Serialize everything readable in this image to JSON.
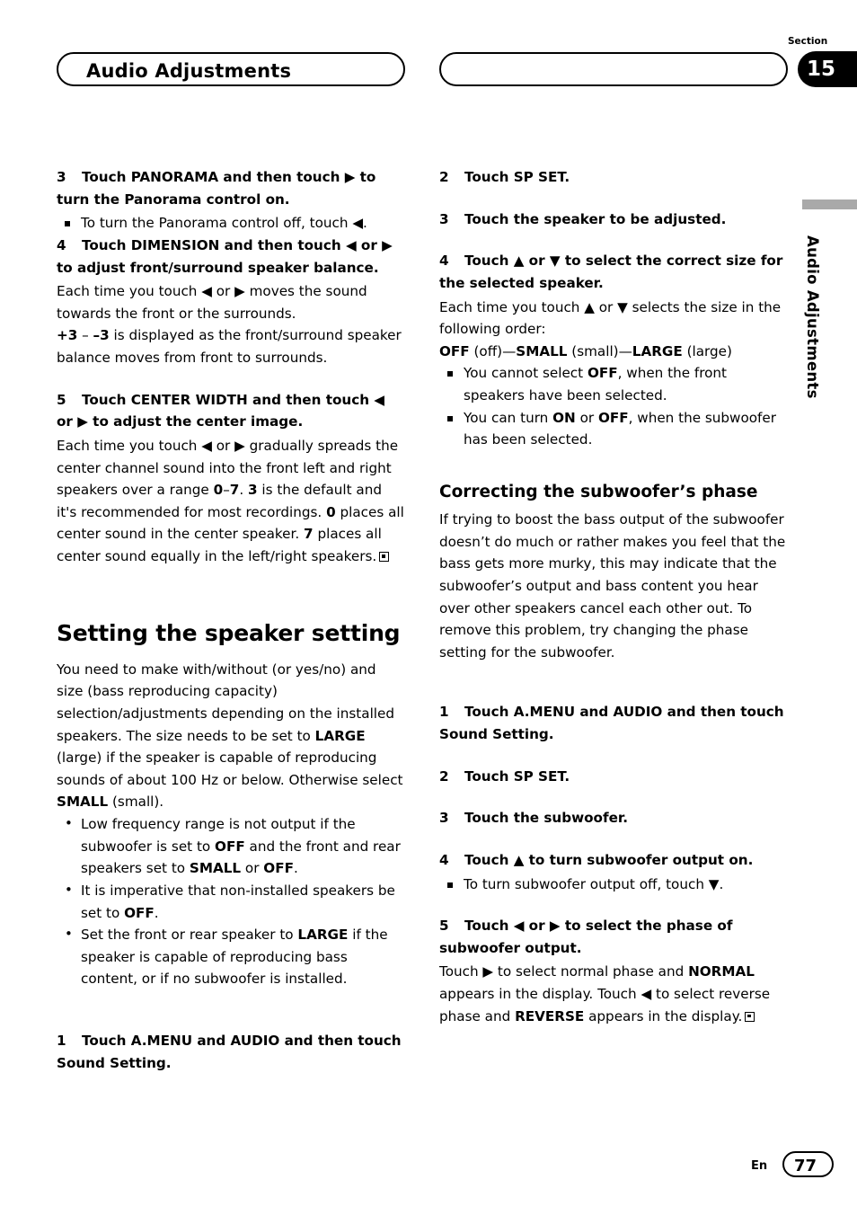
{
  "header": {
    "title": "Audio Adjustments",
    "section_word": "Section",
    "section_number": "15",
    "side_tab": "Audio Adjustments"
  },
  "footer": {
    "lang": "En",
    "page_number": "77"
  },
  "left_column": {
    "step3_heading": "Touch PANORAMA and then touch ▶ to turn the Panorama control on.",
    "step3_num": "3",
    "step3_bullet": "To turn the Panorama control off, touch ◀.",
    "step4_num": "4",
    "step4_heading": "Touch DIMENSION and then touch ◀ or ▶ to adjust front/surround speaker balance.",
    "step4_body1": "Each time you touch ◀ or ▶ moves the sound towards the front or the surrounds.",
    "step4_body2_pre": "",
    "step4_body2": "is displayed as the front/surround speaker balance moves from front to surrounds.",
    "step4_range_a": "+3",
    "step4_range_b": "–3",
    "step5_num": "5",
    "step5_heading": "Touch CENTER WIDTH and then touch ◀ or ▶ to adjust the center image.",
    "step5_body": "Each time you touch ◀ or ▶ gradually spreads the center channel sound into the front left and right speakers over a range 0–7. 3 is the default and it's recommended for most recordings. 0 places all center sound in the center speaker. 7 places all center sound equally in the left/right speakers.",
    "heading_speaker_setting": "Setting the speaker setting",
    "speaker_intro": "You need to make with/without (or yes/no) and size (bass reproducing capacity) selection/adjustments depending on the installed speakers. The size needs to be set to LARGE (large) if the speaker is capable of reproducing sounds of about 100 Hz or below. Otherwise select SMALL (small).",
    "bullet1": "Low frequency range is not output if the subwoofer is set to OFF and the front and rear speakers set to SMALL or OFF.",
    "bullet2": "It is imperative that non-installed speakers be set to OFF.",
    "bullet3": "Set the front or rear speaker to LARGE if the speaker is capable of reproducing bass content, or if no subwoofer is installed.",
    "step1_num": "1",
    "step1_heading": "Touch A.MENU and AUDIO and then touch Sound Setting."
  },
  "right_column": {
    "step2_num": "2",
    "step2_heading": "Touch SP SET.",
    "step3_num": "3",
    "step3_heading": "Touch the speaker to be adjusted.",
    "step4_num": "4",
    "step4_heading": "Touch ▲ or ▼ to select the correct size for the selected speaker.",
    "step4_body1": "Each time you touch ▲ or ▼ selects the size in the following order:",
    "step4_order": "OFF (off)—SMALL (small)—LARGE (large)",
    "step4_bullet1": "You cannot select OFF, when the front speakers have been selected.",
    "step4_bullet2": "You can turn ON or OFF, when the subwoofer has been selected.",
    "heading_phase": "Correcting the subwoofer’s phase",
    "phase_intro": "If trying to boost the bass output of the subwoofer doesn’t do much or rather makes you feel that the bass gets more murky, this may indicate that the subwoofer’s output and bass content you hear over other speakers cancel each other out. To remove this problem, try changing the phase setting for the subwoofer.",
    "p_step1_num": "1",
    "p_step1_heading": "Touch A.MENU and AUDIO and then touch Sound Setting.",
    "p_step2_num": "2",
    "p_step2_heading": "Touch SP SET.",
    "p_step3_num": "3",
    "p_step3_heading": "Touch the subwoofer.",
    "p_step4_num": "4",
    "p_step4_heading": "Touch ▲ to turn subwoofer output on.",
    "p_step4_bullet": "To turn subwoofer output off, touch ▼.",
    "p_step5_num": "5",
    "p_step5_heading": "Touch ◀ or ▶ to select the phase of subwoofer output.",
    "p_step5_body": "Touch ▶ to select normal phase and NORMAL appears in the display. Touch ◀ to select reverse phase and REVERSE appears in the display."
  }
}
